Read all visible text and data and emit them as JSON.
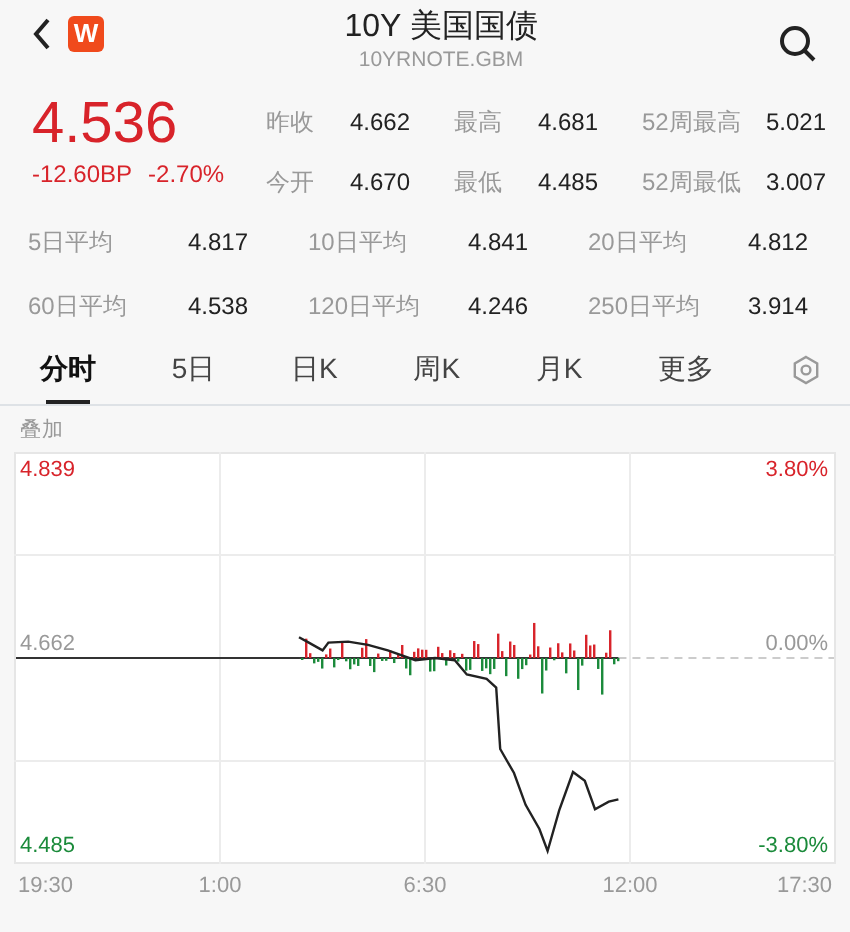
{
  "header": {
    "logo": "W",
    "title": "10Y 美国国债",
    "symbol": "10YRNOTE.GBM"
  },
  "quote": {
    "price": "4.536",
    "change": "-12.60BP",
    "change_pct": "-2.70%"
  },
  "stats": [
    {
      "label": "昨收",
      "value": "4.662"
    },
    {
      "label": "最高",
      "value": "4.681"
    },
    {
      "label": "52周最高",
      "value": "5.021"
    },
    {
      "label": "今开",
      "value": "4.670"
    },
    {
      "label": "最低",
      "value": "4.485"
    },
    {
      "label": "52周最低",
      "value": "3.007"
    }
  ],
  "averages": [
    {
      "label": "5日平均",
      "value": "4.817"
    },
    {
      "label": "10日平均",
      "value": "4.841"
    },
    {
      "label": "20日平均",
      "value": "4.812"
    },
    {
      "label": "60日平均",
      "value": "4.538"
    },
    {
      "label": "120日平均",
      "value": "4.246"
    },
    {
      "label": "250日平均",
      "value": "3.914"
    }
  ],
  "tabs": [
    {
      "label": "分时",
      "selected": true
    },
    {
      "label": "5日",
      "selected": false
    },
    {
      "label": "日K",
      "selected": false
    },
    {
      "label": "周K",
      "selected": false
    },
    {
      "label": "月K",
      "selected": false
    },
    {
      "label": "更多",
      "selected": false
    }
  ],
  "overlay_label": "叠加",
  "chart": {
    "right_labels": [
      "3.80%",
      "0.00%",
      "-3.80%"
    ],
    "time_labels": [
      "19:30",
      "1:00",
      "6:30",
      "12:00",
      "17:30"
    ],
    "price_labels": [
      "4.839",
      "4.662",
      "4.485"
    ]
  }
}
